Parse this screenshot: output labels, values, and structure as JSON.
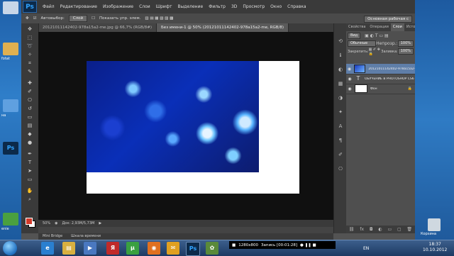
{
  "menubar": {
    "logo": "Ps",
    "items": [
      "Файл",
      "Редактирование",
      "Изображение",
      "Слои",
      "Шрифт",
      "Выделение",
      "Фильтр",
      "3D",
      "Просмотр",
      "Окно",
      "Справка"
    ]
  },
  "options_bar": {
    "autoselect": "Автовыбор:",
    "autoselect_value": "Слой",
    "show_controls": "Показать упр. элем.",
    "workspace": "Основная рабочая с"
  },
  "doc_tabs": [
    "20121011142402-978a15a2-me.jpg @ 66,7% (RGB/8#)",
    "Без имени-1 @ 50% (20121011142402-978a15a2-me, RGB/8)"
  ],
  "status": {
    "zoom": "50%",
    "doc_size": "Док: 2,93M/5,73M"
  },
  "bottom_tabs": [
    "Mini Bridge",
    "Шкала времени"
  ],
  "panel": {
    "tabs": [
      "Свойства",
      "Операции",
      "Слои",
      "История"
    ],
    "active_tab": "Слои",
    "filter": "Вид",
    "blend_mode": "Обычные",
    "opacity_label": "Непрозр.:",
    "opacity_value": "100%",
    "lock_label": "Закрепить:",
    "fill_label": "Заливка:",
    "fill_value": "100%",
    "layers": [
      {
        "name": "20121011142402-978a15a2-me",
        "type": "image",
        "active": true
      },
      {
        "name": "ОБУЧЕНИЕ В PHOTOSHOP CS6",
        "type": "text",
        "active": false
      },
      {
        "name": "Фон",
        "type": "background",
        "active": false
      }
    ]
  },
  "desktop": {
    "recycle_label": "Корзина",
    "left_labels": [
      "fotat",
      "на",
      "Ps",
      "enie"
    ]
  },
  "taskbar": {
    "rec_resolution": "1280x800",
    "rec_label": "Запись [00:01:28]",
    "lang": "EN",
    "time": "18:37",
    "date": "10.10.2012"
  }
}
